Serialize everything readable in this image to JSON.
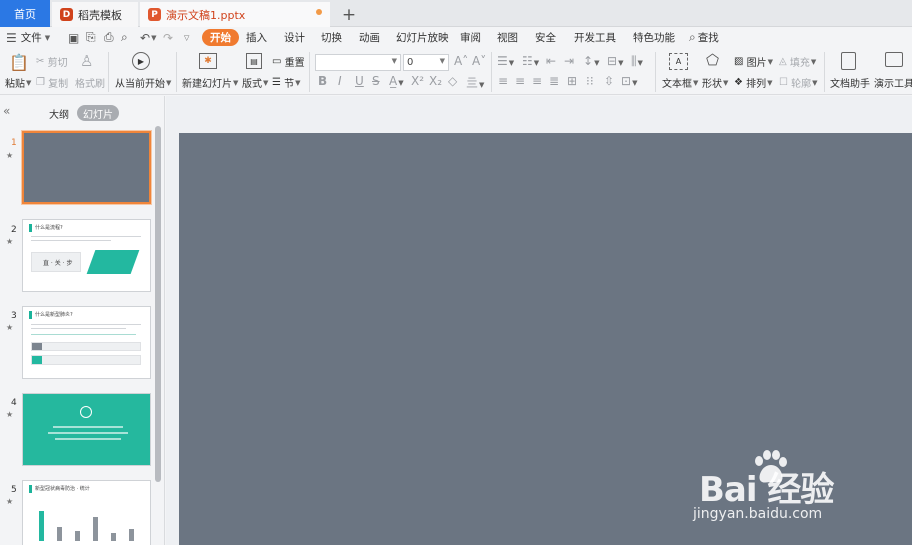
{
  "tabs": {
    "home": "首页",
    "template": "稻壳模板",
    "document": "演示文稿1.pptx",
    "add": "+"
  },
  "menu": {
    "file": "文件",
    "items": [
      "开始",
      "插入",
      "设计",
      "切换",
      "动画",
      "幻灯片放映",
      "审阅",
      "视图",
      "安全",
      "开发工具",
      "特色功能"
    ],
    "search": "查找"
  },
  "ribbon": {
    "paste": "粘贴",
    "cut": "剪切",
    "copy": "复制",
    "format_painter": "格式刷",
    "from_current": "从当前开始",
    "new_slide": "新建幻灯片",
    "layout": "版式",
    "reset": "重置",
    "section": "节",
    "font_size": "0",
    "bold": "B",
    "italic": "I",
    "underline": "U",
    "strike": "S",
    "textbox": "文本框",
    "shape": "形状",
    "picture": "图片",
    "fill": "填充",
    "arrange": "排列",
    "outline": "轮廓",
    "doc_assistant": "文档助手",
    "present_tools": "演示工具"
  },
  "panel": {
    "outline_tab": "大纲",
    "slides_tab": "幻灯片",
    "slides": [
      {
        "num": "1",
        "title": ""
      },
      {
        "num": "2",
        "title": "什么是流程?"
      },
      {
        "num": "3",
        "title": "什么是新型肺炎?"
      },
      {
        "num": "4",
        "title": ""
      },
      {
        "num": "5",
        "title": "新型冠状病毒防治 · 统计"
      }
    ],
    "slide2_mid": "直 · 关 · 步"
  },
  "watermark": {
    "main": "Bai 经验",
    "sub": "jingyan.baidu.com"
  },
  "colors": {
    "accent": "#f07a2f",
    "home_tab": "#2b78e4",
    "slide_bg": "#6b7582",
    "teal": "#23b8a0"
  }
}
